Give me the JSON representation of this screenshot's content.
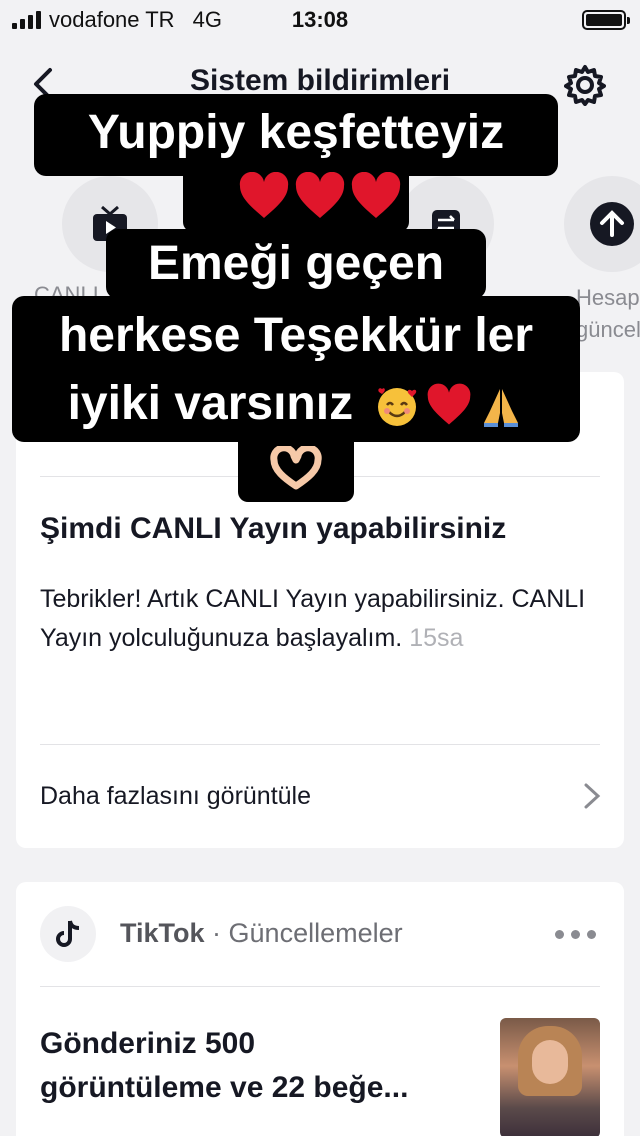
{
  "status_bar": {
    "carrier": "vodafone TR",
    "network": "4G",
    "time": "13:08",
    "battery_level": 1.0
  },
  "header": {
    "title": "Sistem bildirimleri"
  },
  "categories": [
    {
      "label": "CANLI",
      "icon": "live-tv-icon"
    },
    {
      "label": "",
      "icon": "transfer-icon"
    },
    {
      "label": "Hesap\ngüncelle",
      "icon": "upload-arrow-icon"
    }
  ],
  "overlay": {
    "line1": "Yuppiy keşfetteyiz",
    "line2": "Emeği geçen",
    "line3": "herkese Teşekkür ler",
    "line4": "iyiki varsınız"
  },
  "card1": {
    "title": "Şimdi CANLI Yayın yapabilirsiniz",
    "body": "Tebrikler! Artık CANLI Yayın yapabilirsiniz. CANLI Yayın yolculuğunuza başlayalım.",
    "time": "15sa",
    "more_label": "Daha fazlasını görüntüle"
  },
  "card2": {
    "sender_name": "TikTok",
    "sender_separator": " · ",
    "sender_category": "Güncellemeler",
    "title_line1": "Gönderiniz 500",
    "title_line2": "görüntüleme ve 22 beğe..."
  },
  "colors": {
    "background": "#f2f2f4",
    "card": "#ffffff",
    "heart": "#e0162b",
    "muted_text": "#b0b1b6"
  }
}
